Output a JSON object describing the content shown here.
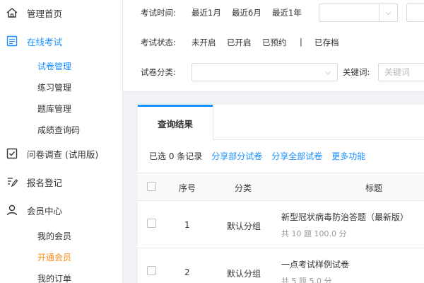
{
  "sidebar": {
    "home": "管理首页",
    "online_exam": "在线考试",
    "online_exam_items": [
      "试卷管理",
      "练习管理",
      "题库管理",
      "成绩查询码"
    ],
    "survey": "问卷调查 (试用版)",
    "registration": "报名登记",
    "member_center": "会员中心",
    "member_items": [
      "我的会员",
      "开通会员",
      "我的订单"
    ]
  },
  "filters": {
    "time_label": "考试时间:",
    "time_options": [
      "最近1月",
      "最近6月",
      "最近1年"
    ],
    "status_label": "考试状态:",
    "status_options": [
      "未开启",
      "已开启",
      "已预约"
    ],
    "status_separator": "|",
    "status_archived": "已存档",
    "category_label": "试卷分类:",
    "keyword_label": "关键词:",
    "keyword_placeholder": "关键词"
  },
  "results": {
    "tab_label": "查询结果",
    "selected_text": "已选 0 条记录",
    "actions": [
      "分享部分试卷",
      "分享全部试卷",
      "更多功能"
    ],
    "columns": {
      "index": "序号",
      "category": "分类",
      "title": "标题"
    },
    "rows": [
      {
        "index": "1",
        "category": "默认分组",
        "title": "新型冠状病毒防治答题（最新版）",
        "summary": "共 10 题 100.0 分"
      },
      {
        "index": "2",
        "category": "默认分组",
        "title": "一点考试样例试卷",
        "summary": "共 5 题 5.0 分"
      }
    ]
  },
  "colors": {
    "accent": "#1890ff",
    "highlight": "#fa8c16"
  }
}
